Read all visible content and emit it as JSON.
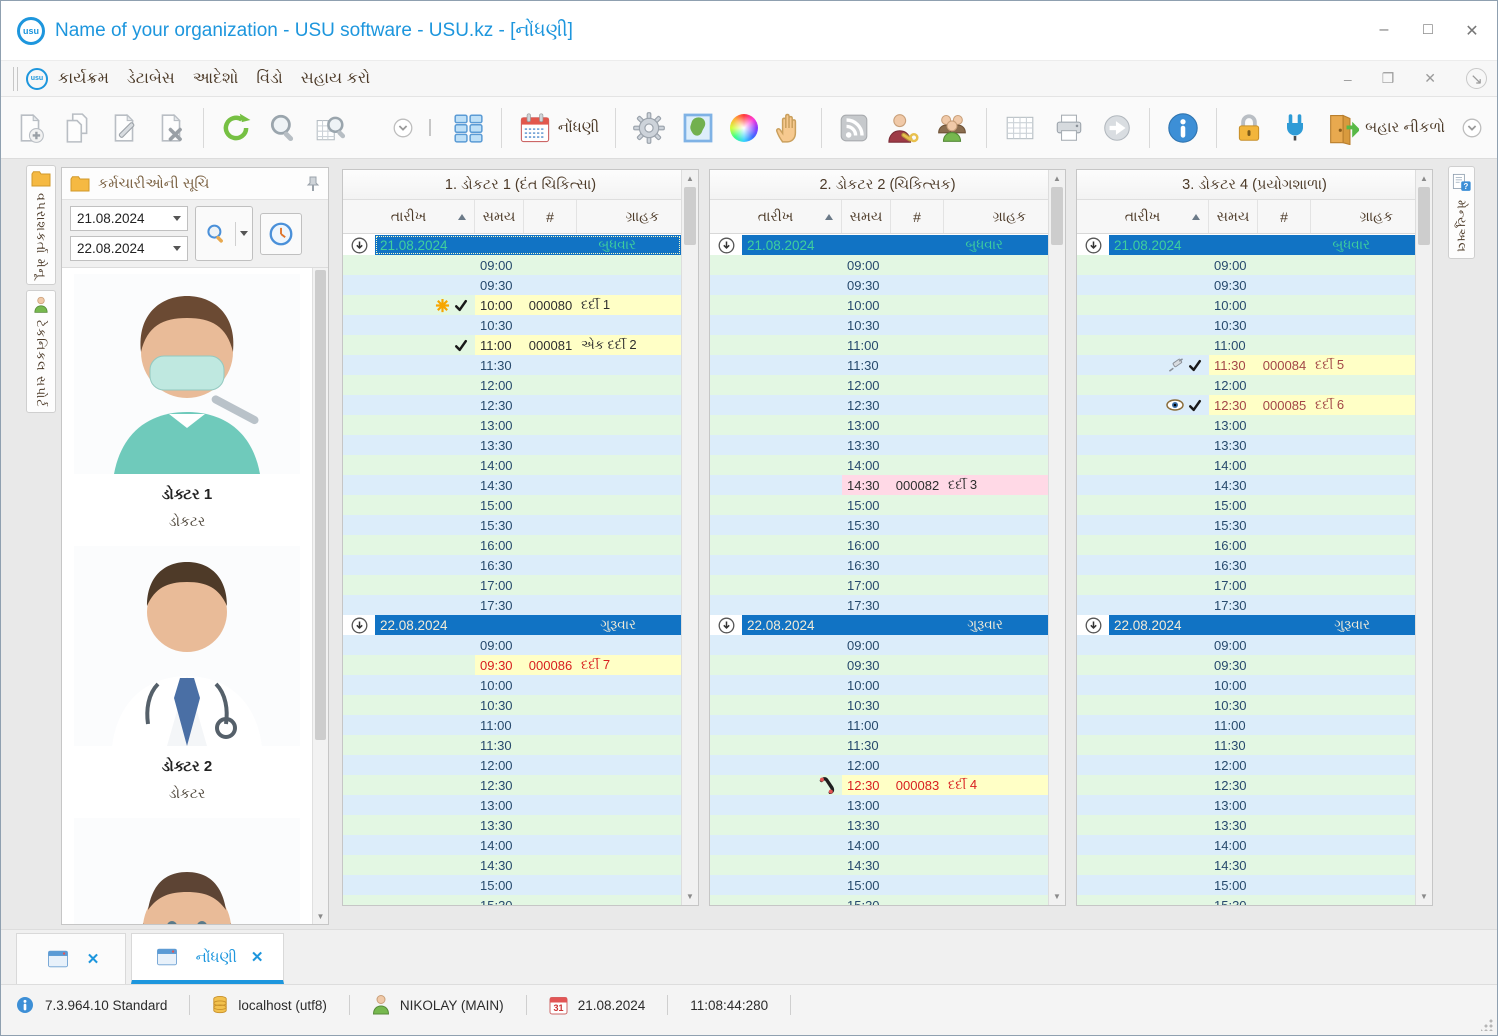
{
  "window": {
    "title": "Name of your organization - USU software - USU.kz - [નોંધણી]"
  },
  "menu": {
    "items": [
      "કાર્યક્રમ",
      "ડેટાબેસ",
      "આદેશો",
      "વિંડો",
      "સહાય કરો"
    ]
  },
  "toolbar": {
    "register_label": "નોંધણી",
    "exit_label": "બહાર નીકળો",
    "items": [
      {
        "icon": "new-document"
      },
      {
        "icon": "copy-document"
      },
      {
        "icon": "edit-document"
      },
      {
        "icon": "delete-document"
      },
      {
        "icon": "separator"
      },
      {
        "icon": "refresh"
      },
      {
        "icon": "search"
      },
      {
        "icon": "report-search"
      },
      {
        "icon": "spacer"
      },
      {
        "icon": "collapse-arrow"
      },
      {
        "icon": "grip"
      },
      {
        "icon": "tiles"
      },
      {
        "icon": "separator"
      },
      {
        "icon": "calendar",
        "label": "નોંધણી"
      },
      {
        "icon": "separator"
      },
      {
        "icon": "settings"
      },
      {
        "icon": "map"
      },
      {
        "icon": "color-wheel"
      },
      {
        "icon": "hand"
      },
      {
        "icon": "separator"
      },
      {
        "icon": "rss"
      },
      {
        "icon": "user-key"
      },
      {
        "icon": "users"
      },
      {
        "icon": "separator"
      },
      {
        "icon": "table"
      },
      {
        "icon": "printer"
      },
      {
        "icon": "go-arrow"
      },
      {
        "icon": "separator"
      },
      {
        "icon": "info"
      },
      {
        "icon": "separator"
      },
      {
        "icon": "lock"
      },
      {
        "icon": "plug"
      },
      {
        "icon": "exit-door",
        "label": "બહાર નીકળો"
      },
      {
        "icon": "collapse-arrow",
        "push_right": true
      }
    ]
  },
  "side_tabs": {
    "left": [
      {
        "icon": "folder-icon",
        "label": "વપરાશકર્તા મેનૂ"
      },
      {
        "icon": "person-icon",
        "label": "ટેકનિકલ સપોર્ટ"
      }
    ],
    "right": {
      "icon": "manual-doc-icon",
      "label": "મેન્યુઅલ"
    }
  },
  "panel": {
    "title": "કર્મચારીઓની સૂચિ",
    "date_from": "21.08.2024",
    "date_to": "22.08.2024",
    "doctors": [
      {
        "name": "ડોક્ટર 1",
        "role": "ડોકટર",
        "photo": "female-dentist"
      },
      {
        "name": "ડોક્ટર 2",
        "role": "ડોકટર",
        "photo": "male-doctor"
      },
      {
        "name": "",
        "role": "",
        "photo": "female-face"
      }
    ]
  },
  "schedule": {
    "headers": [
      "તારીખ",
      "સમય",
      "#",
      "ગ્રાહક"
    ],
    "times": [
      "09:00",
      "09:30",
      "10:00",
      "10:30",
      "11:00",
      "11:30",
      "12:00",
      "12:30",
      "13:00",
      "13:30",
      "14:00",
      "14:30",
      "15:00",
      "15:30",
      "16:00",
      "16:30",
      "17:00",
      "17:30"
    ],
    "columns": [
      {
        "title": "1. ડોકટર 1 (દંત ચિકિત્સા)",
        "sections": [
          {
            "date": "21.08.2024",
            "weekday": "બુધવાર",
            "selected": true,
            "focused": true,
            "appointments": [
              {
                "time": "10:00",
                "num": "000080",
                "client": "દર્દી 1",
                "icons": [
                  "star",
                  "check"
                ],
                "style": "dark",
                "band": "yellow"
              },
              {
                "time": "11:00",
                "num": "000081",
                "client": "એક દર્દી 2",
                "icons": [
                  "check"
                ],
                "style": "dark",
                "band": "yellow"
              }
            ]
          },
          {
            "date": "22.08.2024",
            "weekday": "ગુરૂવાર",
            "selected": false,
            "focused": false,
            "appointments": [
              {
                "time": "09:30",
                "num": "000086",
                "client": "દર્દી 7",
                "icons": [],
                "style": "red",
                "band": "yellow"
              }
            ]
          }
        ]
      },
      {
        "title": "2. ડોકટર 2 (ચિકિત્સક)",
        "sections": [
          {
            "date": "21.08.2024",
            "weekday": "બુધવાર",
            "selected": true,
            "focused": false,
            "appointments": [
              {
                "time": "14:30",
                "num": "000082",
                "client": "દર્દી 3",
                "icons": [],
                "style": "dark",
                "band": "pink"
              }
            ]
          },
          {
            "date": "22.08.2024",
            "weekday": "ગુરૂવાર",
            "selected": false,
            "focused": false,
            "appointments": [
              {
                "time": "12:30",
                "num": "000083",
                "client": "દર્દી 4",
                "icons": [
                  "phone"
                ],
                "style": "red",
                "band": "yellow"
              }
            ]
          }
        ]
      },
      {
        "title": "3. ડોકટર 4 (પ્રયોગશાળા)",
        "sections": [
          {
            "date": "21.08.2024",
            "weekday": "બુધવાર",
            "selected": true,
            "focused": false,
            "appointments": [
              {
                "time": "11:30",
                "num": "000084",
                "client": "દર્દી 5",
                "icons": [
                  "syringe",
                  "check"
                ],
                "style": "darkred",
                "band": "yellow"
              },
              {
                "time": "12:30",
                "num": "000085",
                "client": "દર્દી 6",
                "icons": [
                  "eye",
                  "check"
                ],
                "style": "darkred",
                "band": "yellow"
              }
            ]
          },
          {
            "date": "22.08.2024",
            "weekday": "ગુરૂવાર",
            "selected": false,
            "focused": false,
            "appointments": []
          }
        ]
      }
    ]
  },
  "tabs": {
    "items": [
      {
        "label": "",
        "active": false
      },
      {
        "label": "નોંધણી",
        "active": true
      }
    ]
  },
  "status": {
    "version": "7.3.964.10 Standard",
    "database": "localhost (utf8)",
    "user": "NIKOLAY (MAIN)",
    "date": "21.08.2024",
    "time": "11:08:44:280"
  },
  "colors": {
    "accent": "#1d96dd",
    "separator_blue": "#1173c4",
    "row_green": "#e3f7e3",
    "row_blue": "#dcedfa",
    "row_yellow": "#ffffc6",
    "row_pink": "#ffd9e6",
    "appt_dark": "#2e2e2e",
    "appt_red": "#d81f1f",
    "appt_darkred": "#a34747",
    "sep_selected_text": "#3fcf9d",
    "sep_text": "#f2ecd8"
  }
}
